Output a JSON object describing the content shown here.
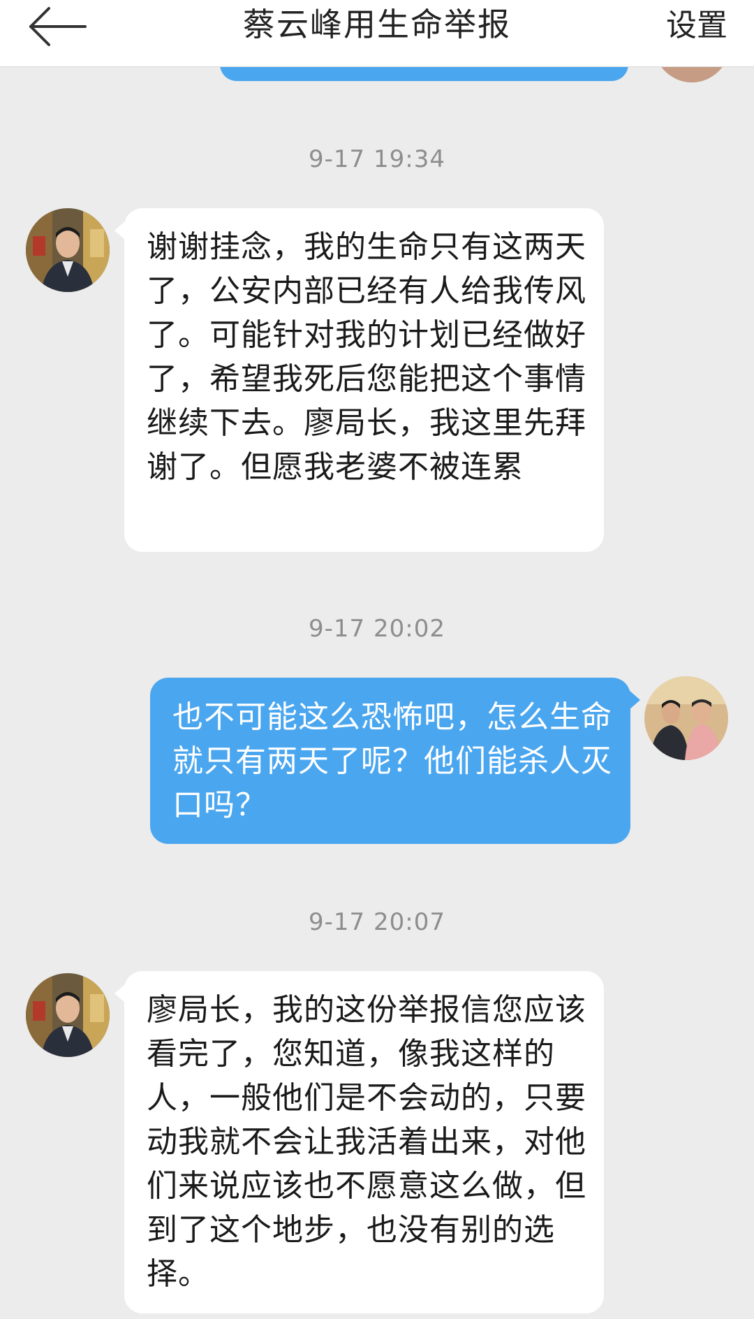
{
  "header": {
    "title": "蔡云峰用生命举报",
    "settings_label": "设置"
  },
  "messages": [
    {
      "timestamp": "9-17 19:34",
      "direction": "incoming",
      "text": "谢谢挂念，我的生命只有这两天了，公安内部已经有人给我传风了。可能针对我的计划已经做好了，希望我死后您能把这个事情继续下去。廖局长，我这里先拜谢了。但愿我老婆不被连累"
    },
    {
      "timestamp": "9-17 20:02",
      "direction": "outgoing",
      "text": "也不可能这么恐怖吧，怎么生命就只有两天了呢？他们能杀人灭口吗？"
    },
    {
      "timestamp": "9-17 20:07",
      "direction": "incoming",
      "text": "廖局长，我的这份举报信您应该看完了，您知道，像我这样的人，一般他们是不会动的，只要动我就不会让我活着出来，对他们来说应该也不愿意这么做，但到了这个地步，也没有别的选择。"
    }
  ],
  "colors": {
    "background": "#ececec",
    "outgoing_bubble": "#4aa6ef",
    "incoming_bubble": "#ffffff",
    "timestamp_text": "#8d8d8d"
  },
  "icons": {
    "back": "arrow-left-icon"
  }
}
